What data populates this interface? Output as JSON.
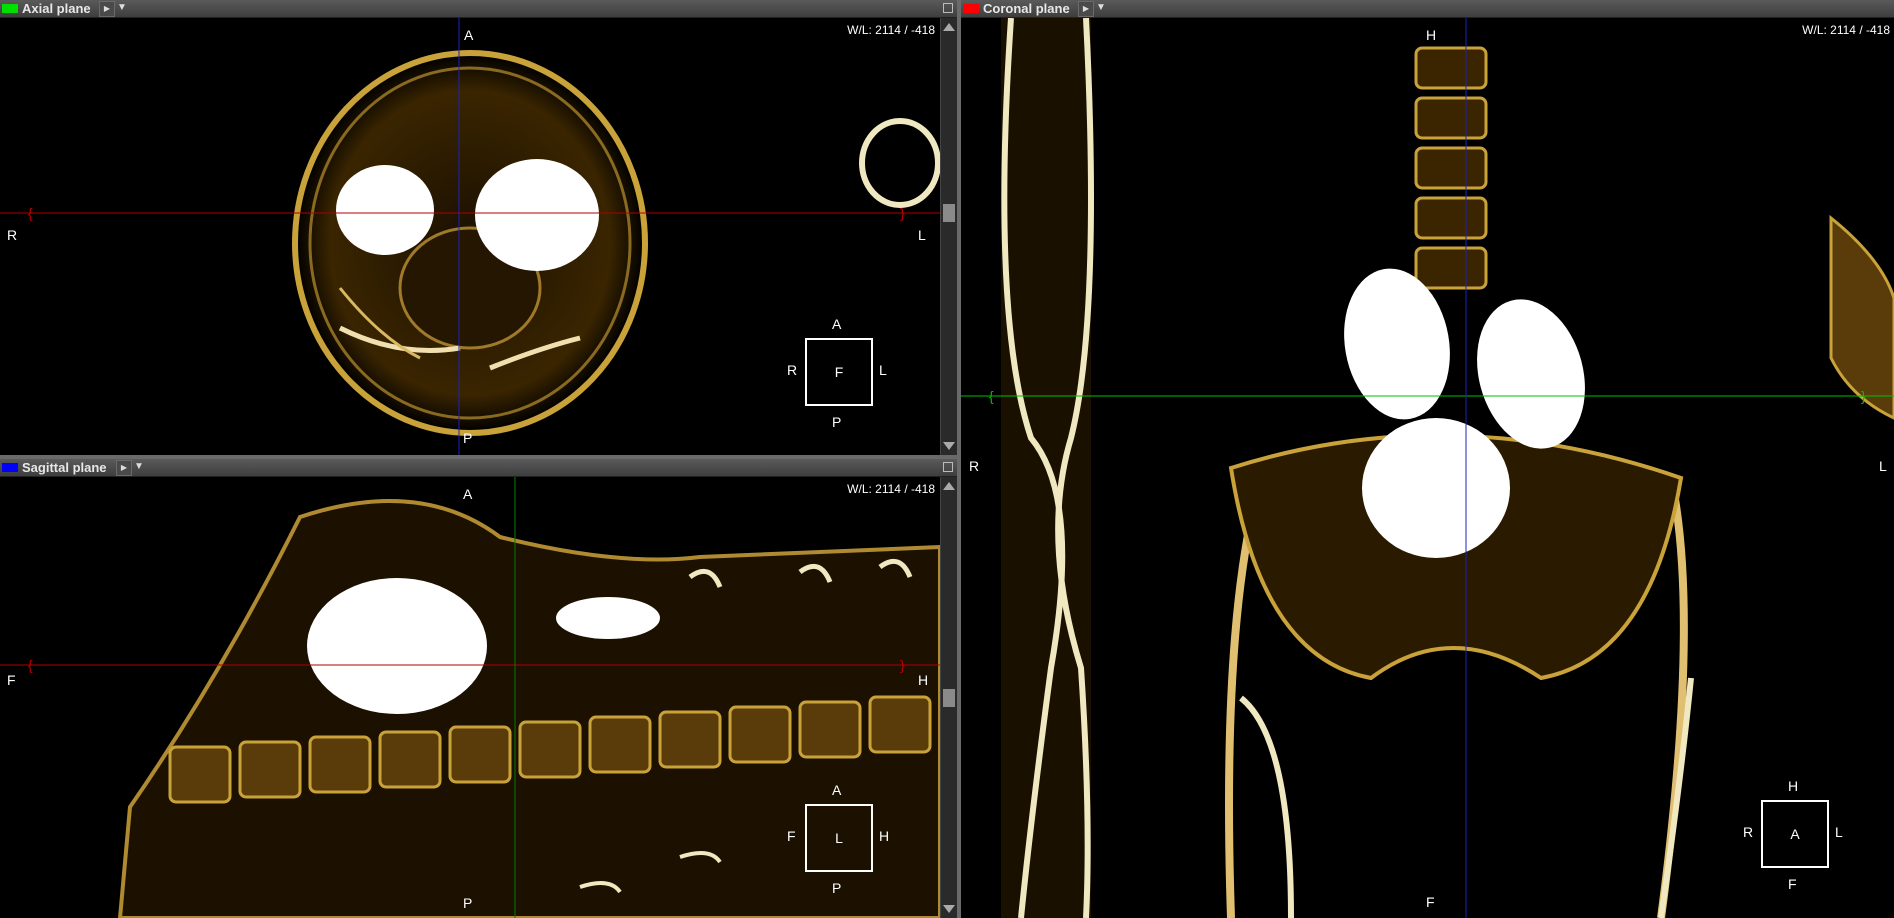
{
  "axial": {
    "title": "Axial plane",
    "color": "#00e000",
    "wl": "W/L: 2114 / -418",
    "labels": {
      "top": "A",
      "bottom": "P",
      "left": "R",
      "right": "L"
    },
    "orientation_box": {
      "center": "F",
      "top": "A",
      "bottom": "P",
      "left": "R",
      "right": "L"
    }
  },
  "sagittal": {
    "title": "Sagittal plane",
    "color": "#0000ff",
    "wl": "W/L: 2114 / -418",
    "labels": {
      "top": "A",
      "bottom": "P",
      "left": "F",
      "right": "H"
    },
    "orientation_box": {
      "center": "L",
      "top": "A",
      "bottom": "P",
      "left": "F",
      "right": "H"
    }
  },
  "coronal": {
    "title": "Coronal plane",
    "color": "#ff0000",
    "wl": "W/L: 2114 / -418",
    "labels": {
      "top": "H",
      "bottom": "F",
      "left": "R",
      "right": "L"
    },
    "orientation_box": {
      "center": "A",
      "top": "H",
      "bottom": "F",
      "left": "R",
      "right": "L"
    }
  },
  "icons": {
    "play": "play-icon",
    "dropdown": "chevron-down-icon",
    "maximize": "maximize-icon"
  }
}
